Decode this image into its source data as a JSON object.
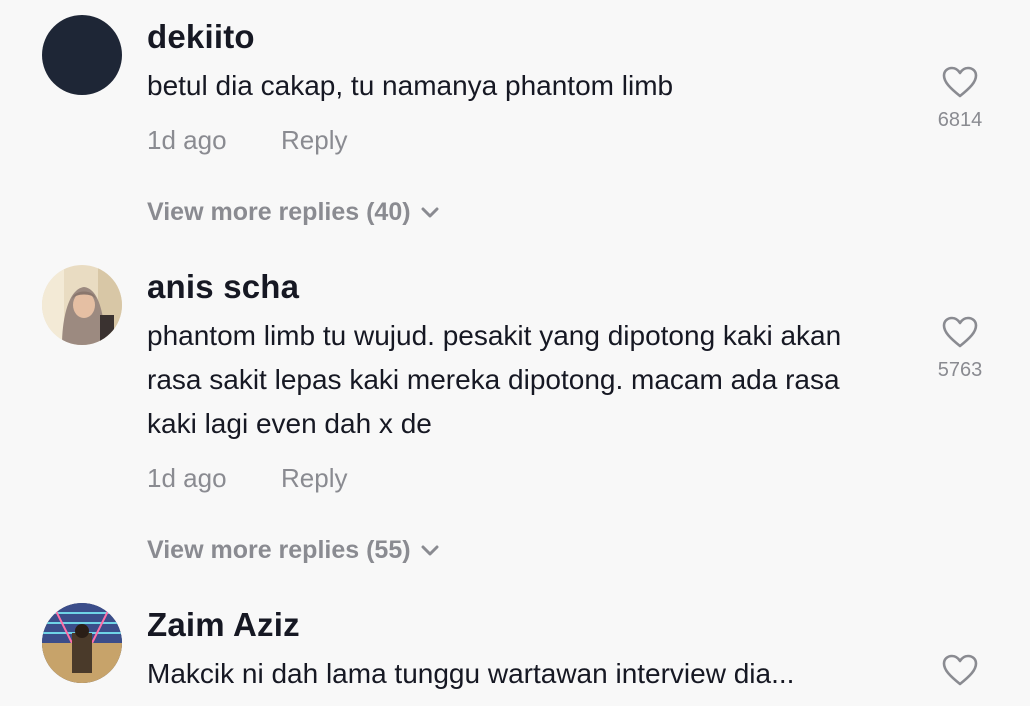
{
  "comments": [
    {
      "username": "dekiito",
      "text": "betul dia cakap, tu namanya phantom limb",
      "time": "1d ago",
      "reply_label": "Reply",
      "likes": "6814",
      "view_more": "View more replies (40)"
    },
    {
      "username": "anis scha",
      "text": "phantom limb tu wujud. pesakit yang dipotong kaki akan rasa sakit lepas kaki mereka dipotong. macam ada rasa kaki lagi even dah x de",
      "time": "1d ago",
      "reply_label": "Reply",
      "likes": "5763",
      "view_more": "View more replies (55)"
    },
    {
      "username": "Zaim Aziz",
      "text": "Makcik ni dah lama tunggu wartawan interview dia..."
    }
  ],
  "colors": {
    "background": "#f8f8f8",
    "primary_text": "#161823",
    "secondary_text": "#8a8b91",
    "avatar_dark": "#1e2636"
  },
  "icons": {
    "like": "heart-outline-icon",
    "expand": "chevron-down-icon"
  }
}
